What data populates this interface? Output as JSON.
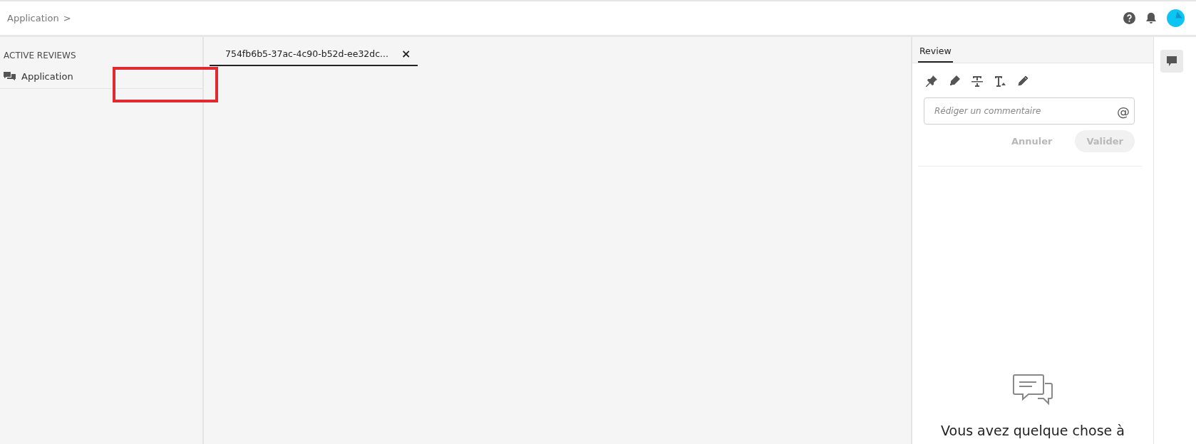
{
  "breadcrumb": {
    "label": "Application",
    "separator": ">"
  },
  "sidebar": {
    "heading": "ACTIVE REVIEWS",
    "items": [
      {
        "label": "Application",
        "selected": false,
        "highlighted": true
      }
    ]
  },
  "tabs": [
    {
      "label": "754fb6b5-37ac-4c90-b52d-ee32dc...",
      "selected": true,
      "close": "×"
    }
  ],
  "review": {
    "tabs": [
      {
        "label": "Review",
        "selected": true
      }
    ],
    "tools": [
      {
        "kind": "pin"
      },
      {
        "kind": "highlighter"
      },
      {
        "kind": "strikethrough"
      },
      {
        "kind": "text-insert"
      },
      {
        "kind": "pencil"
      }
    ],
    "comment": {
      "placeholder": "Rédiger un commentaire",
      "mention": "@"
    },
    "buttons": [
      {
        "label": "Annuler",
        "kind": "text",
        "disabled": true
      },
      {
        "label": "Valider",
        "kind": "filled",
        "disabled": true
      }
    ],
    "empty_message": "Vous avez quelque chose à"
  }
}
